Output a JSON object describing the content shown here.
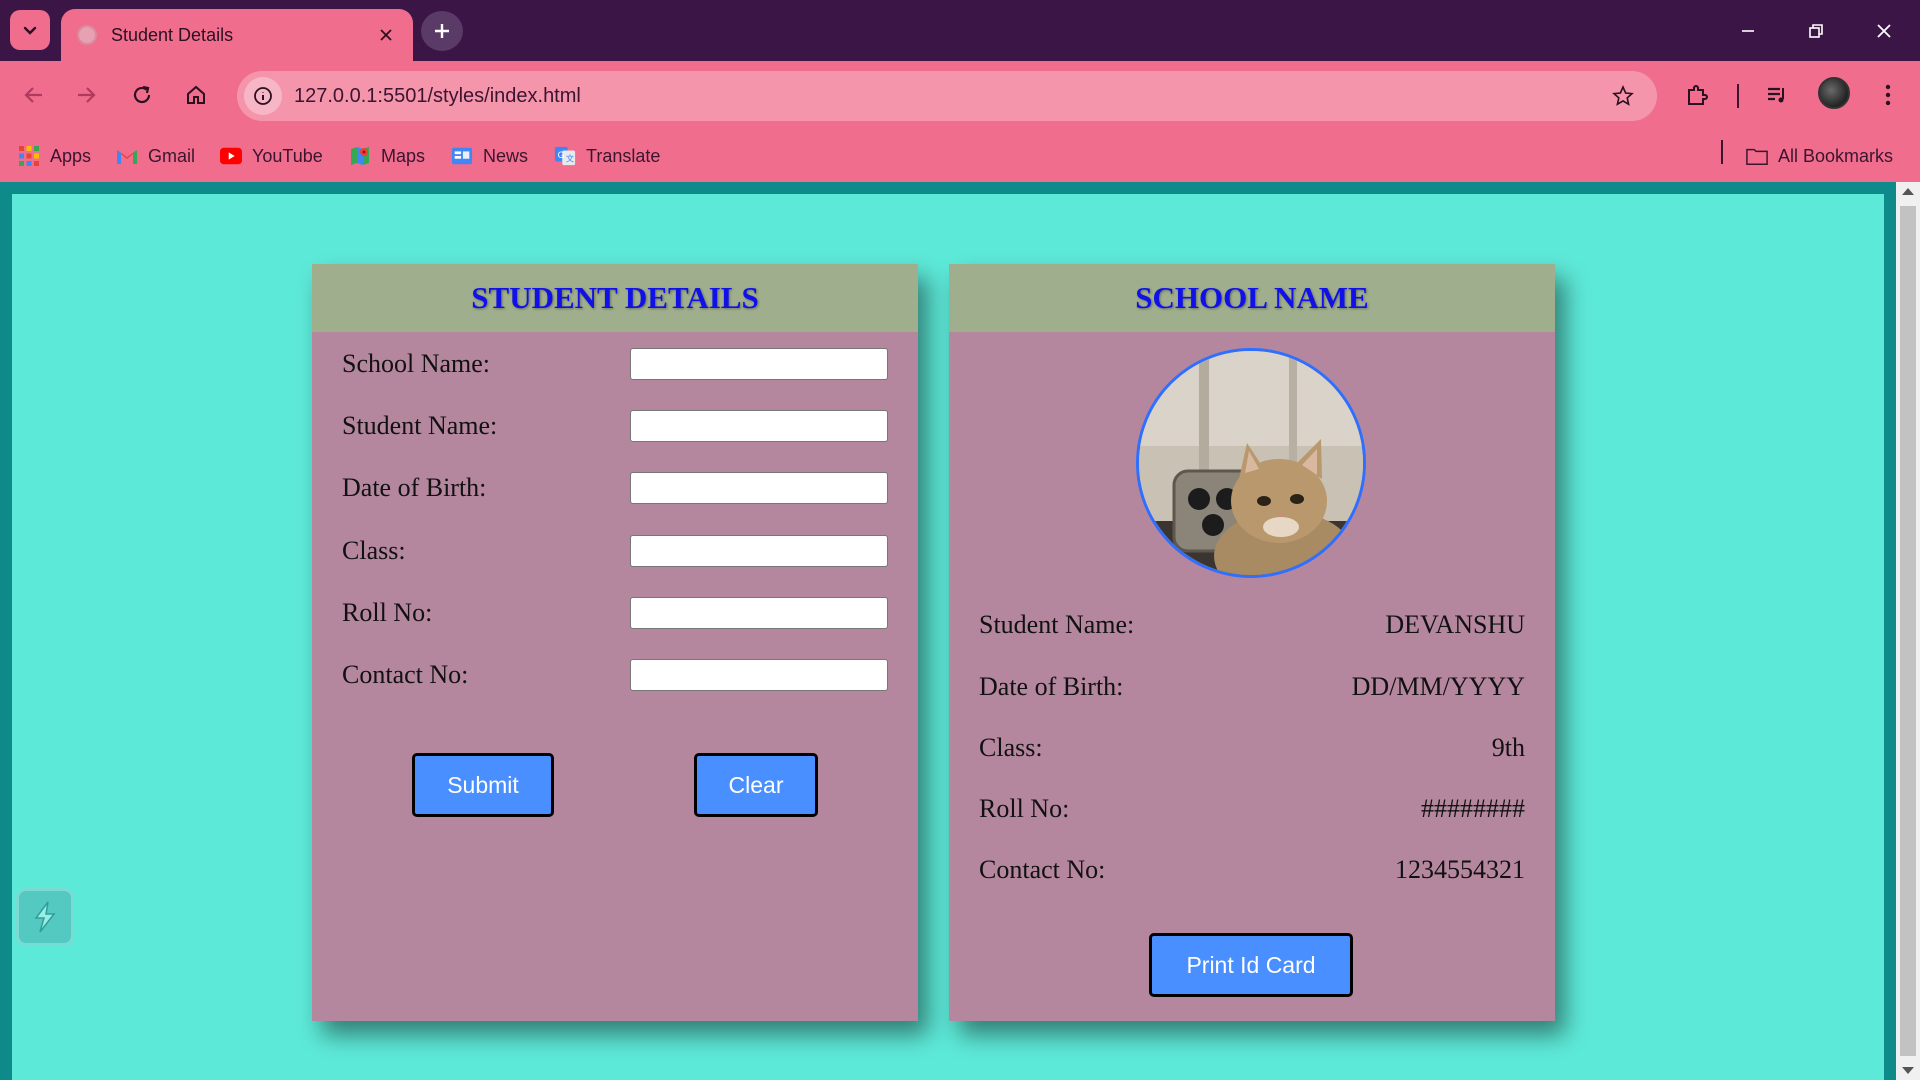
{
  "browser": {
    "tab_title": "Student Details",
    "url": "127.0.0.1:5501/styles/index.html",
    "bookmarks": [
      {
        "label": "Apps",
        "icon": "apps-grid-icon"
      },
      {
        "label": "Gmail",
        "icon": "gmail-icon"
      },
      {
        "label": "YouTube",
        "icon": "youtube-icon"
      },
      {
        "label": "Maps",
        "icon": "maps-icon"
      },
      {
        "label": "News",
        "icon": "news-icon"
      },
      {
        "label": "Translate",
        "icon": "translate-icon"
      }
    ],
    "all_bookmarks_label": "All Bookmarks",
    "colors": {
      "frame": "#3b1545",
      "toolbar": "#f06d8e"
    }
  },
  "form_card": {
    "title": "STUDENT DETAILS",
    "fields": [
      {
        "label": "School Name:",
        "value": ""
      },
      {
        "label": "Student Name:",
        "value": ""
      },
      {
        "label": "Date of Birth:",
        "value": ""
      },
      {
        "label": "Class:",
        "value": ""
      },
      {
        "label": "Roll No:",
        "value": ""
      },
      {
        "label": "Contact No:",
        "value": ""
      }
    ],
    "submit_label": "Submit",
    "clear_label": "Clear"
  },
  "id_card": {
    "title": "SCHOOL NAME",
    "photo_icon": "student-photo",
    "rows": [
      {
        "label": "Student Name:",
        "value": "DEVANSHU"
      },
      {
        "label": "Date of Birth:",
        "value": "DD/MM/YYYY"
      },
      {
        "label": "Class:",
        "value": "9th"
      },
      {
        "label": "Roll No:",
        "value": "########"
      },
      {
        "label": "Contact No:",
        "value": "1234554321"
      }
    ],
    "print_label": "Print Id Card"
  },
  "theme": {
    "page_bg": "#5de9d8",
    "card_bg": "#b5879f",
    "header_bg": "#9fae8d",
    "title_color": "#1010e8",
    "button_bg": "#4a8fff"
  }
}
